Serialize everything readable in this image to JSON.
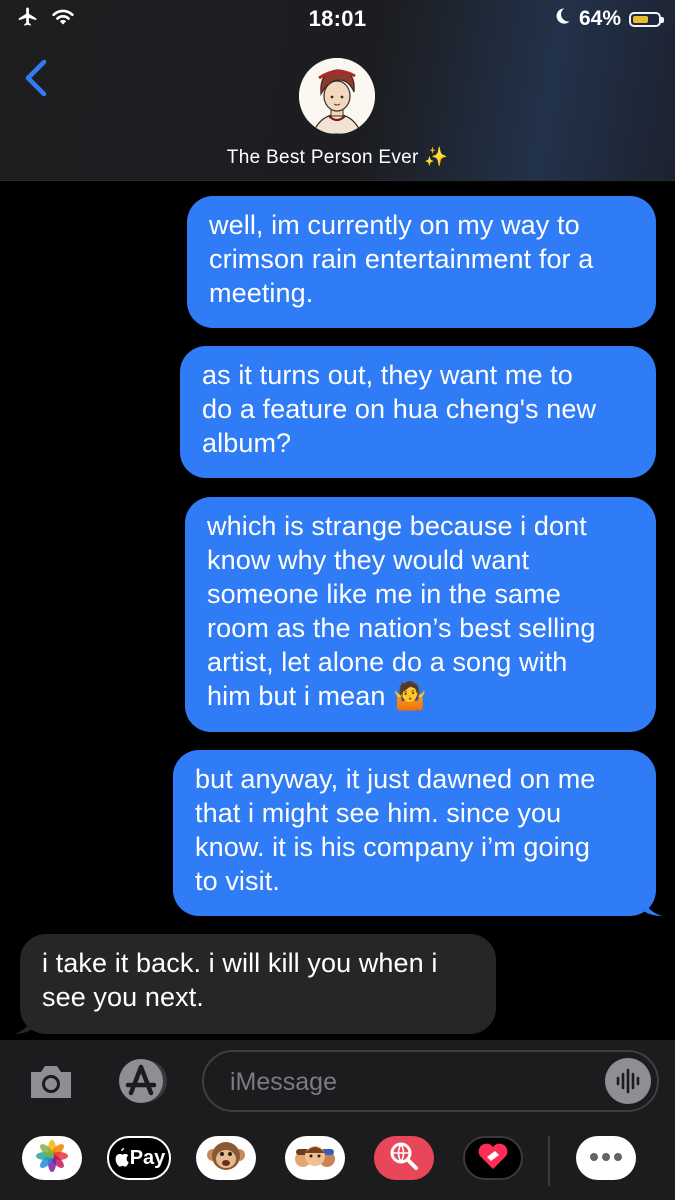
{
  "status_bar": {
    "time": "18:01",
    "battery_percent": "64%",
    "battery_level": 0.64,
    "icons": [
      "airplane-mode-icon",
      "wifi-icon",
      "moon-icon",
      "battery-icon"
    ]
  },
  "header": {
    "contact_name": "The Best Person Ever ✨",
    "back_icon": "chevron-left-icon"
  },
  "messages": [
    {
      "direction": "sent",
      "text": "well, im currently on my way to\ncrimson rain entertainment for a\nmeeting."
    },
    {
      "direction": "sent",
      "text": "as it turns out, they want me to\ndo a feature on hua cheng's new\nalbum?"
    },
    {
      "direction": "sent",
      "text": "which is strange because i dont\nknow why they would want\nsomeone like me in the same\nroom as the nation’s best selling\nartist, let alone do a song with\nhim but i mean 🤷"
    },
    {
      "direction": "sent",
      "text": "but anyway, it just dawned on me\nthat i might see him. since you\nknow. it is his company i’m going\nto visit."
    },
    {
      "direction": "received",
      "text": "i take it back. i will kill you when i\nsee you next."
    }
  ],
  "composer": {
    "placeholder": "iMessage",
    "buttons": [
      "camera-icon",
      "app-store-icon",
      "audio-message-icon"
    ]
  },
  "app_drawer": {
    "apps": [
      "photos-icon",
      "apple-pay-icon",
      "animoji-icon",
      "memoji-icon",
      "web-search-icon",
      "digital-touch-icon",
      "more-apps-icon"
    ],
    "apple_pay_label": "Pay"
  },
  "colors": {
    "sent_bubble": "#2f7cf6",
    "received_bubble": "#262628",
    "accent": "#2f7cf6"
  }
}
